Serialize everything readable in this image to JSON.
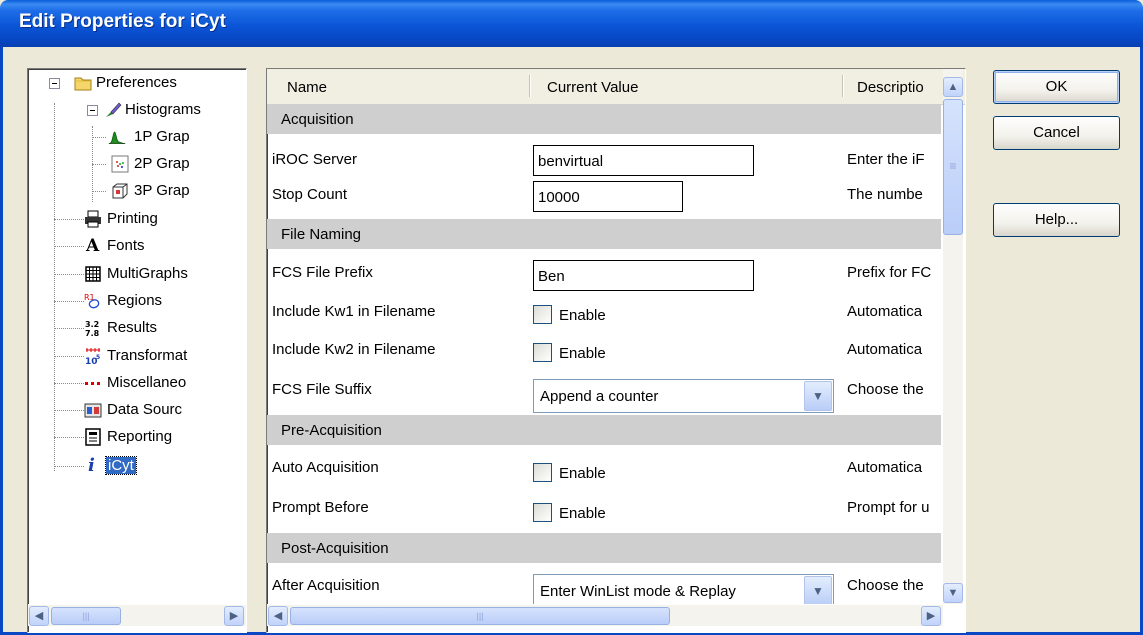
{
  "window": {
    "title": "Edit Properties for iCyt"
  },
  "tree": {
    "items": [
      {
        "label": "Preferences",
        "icon": "folder-icon"
      },
      {
        "label": "Histograms",
        "icon": "brush-icon"
      },
      {
        "label": "1P Grap",
        "icon": "1p-graph-icon"
      },
      {
        "label": "2P Grap",
        "icon": "2p-graph-icon"
      },
      {
        "label": "3P Grap",
        "icon": "3p-graph-icon"
      },
      {
        "label": "Printing",
        "icon": "printer-icon"
      },
      {
        "label": "Fonts",
        "icon": "font-icon"
      },
      {
        "label": "MultiGraphs",
        "icon": "multigraph-icon"
      },
      {
        "label": "Regions",
        "icon": "regions-icon"
      },
      {
        "label": "Results",
        "icon": "results-icon"
      },
      {
        "label": "Transformat",
        "icon": "transformation-icon"
      },
      {
        "label": "Miscellaneo",
        "icon": "miscellaneous-icon"
      },
      {
        "label": "Data Sourc",
        "icon": "data-source-icon"
      },
      {
        "label": "Reporting",
        "icon": "reporting-icon"
      },
      {
        "label": "iCyt",
        "icon": "info-icon"
      }
    ],
    "selected": "iCyt"
  },
  "grid": {
    "columns": [
      "Name",
      "Current Value",
      "Descriptio"
    ],
    "groups": {
      "acquisition": "Acquisition",
      "file_naming": "File Naming",
      "pre_acquisition": "Pre-Acquisition",
      "post_acquisition": "Post-Acquisition"
    },
    "rows": {
      "iroc_server": {
        "name": "iROC Server",
        "value": "benvirtual",
        "desc": "Enter the iF"
      },
      "stop_count": {
        "name": "Stop Count",
        "value": "10000",
        "desc": "The numbe"
      },
      "fcs_prefix": {
        "name": "FCS File Prefix",
        "value": "Ben",
        "desc": "Prefix for FC"
      },
      "kw1": {
        "name": "Include Kw1 in Filename",
        "value": "Enable",
        "desc": "Automatica"
      },
      "kw2": {
        "name": "Include Kw2 in Filename",
        "value": "Enable",
        "desc": "Automatica"
      },
      "fcs_suffix": {
        "name": "FCS File Suffix",
        "value": "Append a counter",
        "desc": "Choose the"
      },
      "auto_acq": {
        "name": "Auto Acquisition",
        "value": "Enable",
        "desc": "Automatica"
      },
      "prompt_before": {
        "name": "Prompt Before",
        "value": "Enable",
        "desc": "Prompt for u"
      },
      "after_acq": {
        "name": "After Acquisition",
        "value": "Enter WinList mode & Replay",
        "desc": "Choose the"
      }
    },
    "scroll_thumb_glyph": "≡",
    "hscroll_thumb_glyph": "|||"
  },
  "buttons": {
    "ok": "OK",
    "cancel": "Cancel",
    "help": "Help..."
  },
  "colors": {
    "title_bar": "#0a55d6",
    "selection": "#316ac5",
    "group_row": "#cfcfcf",
    "dialog_bg": "#ece9d8"
  }
}
